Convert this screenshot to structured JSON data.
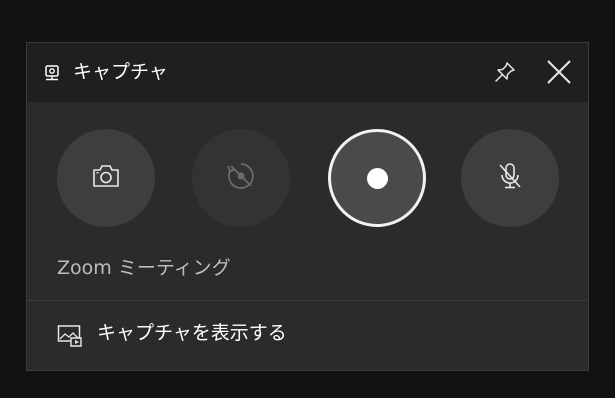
{
  "widget": {
    "title": "キャプチャ",
    "icons": {
      "title": "webcam-icon",
      "pin": "pin-icon",
      "close": "close-icon"
    }
  },
  "controls": [
    {
      "name": "screenshot",
      "icon": "camera-icon"
    },
    {
      "name": "record-last-30-seconds",
      "icon": "record-last-disabled-icon"
    },
    {
      "name": "start-recording",
      "icon": "record-dot-icon"
    },
    {
      "name": "microphone",
      "icon": "mic-off-icon"
    }
  ],
  "app_name": "Zoom ミーティング",
  "gallery": {
    "label": "キャプチャを表示する",
    "icon": "gallery-icon"
  },
  "colors": {
    "background": "#121212",
    "panel": "#2b2b2b",
    "titlebar": "#1f1f1f",
    "button": "#3e3e3e",
    "record_ring": "#f2f2f2"
  }
}
